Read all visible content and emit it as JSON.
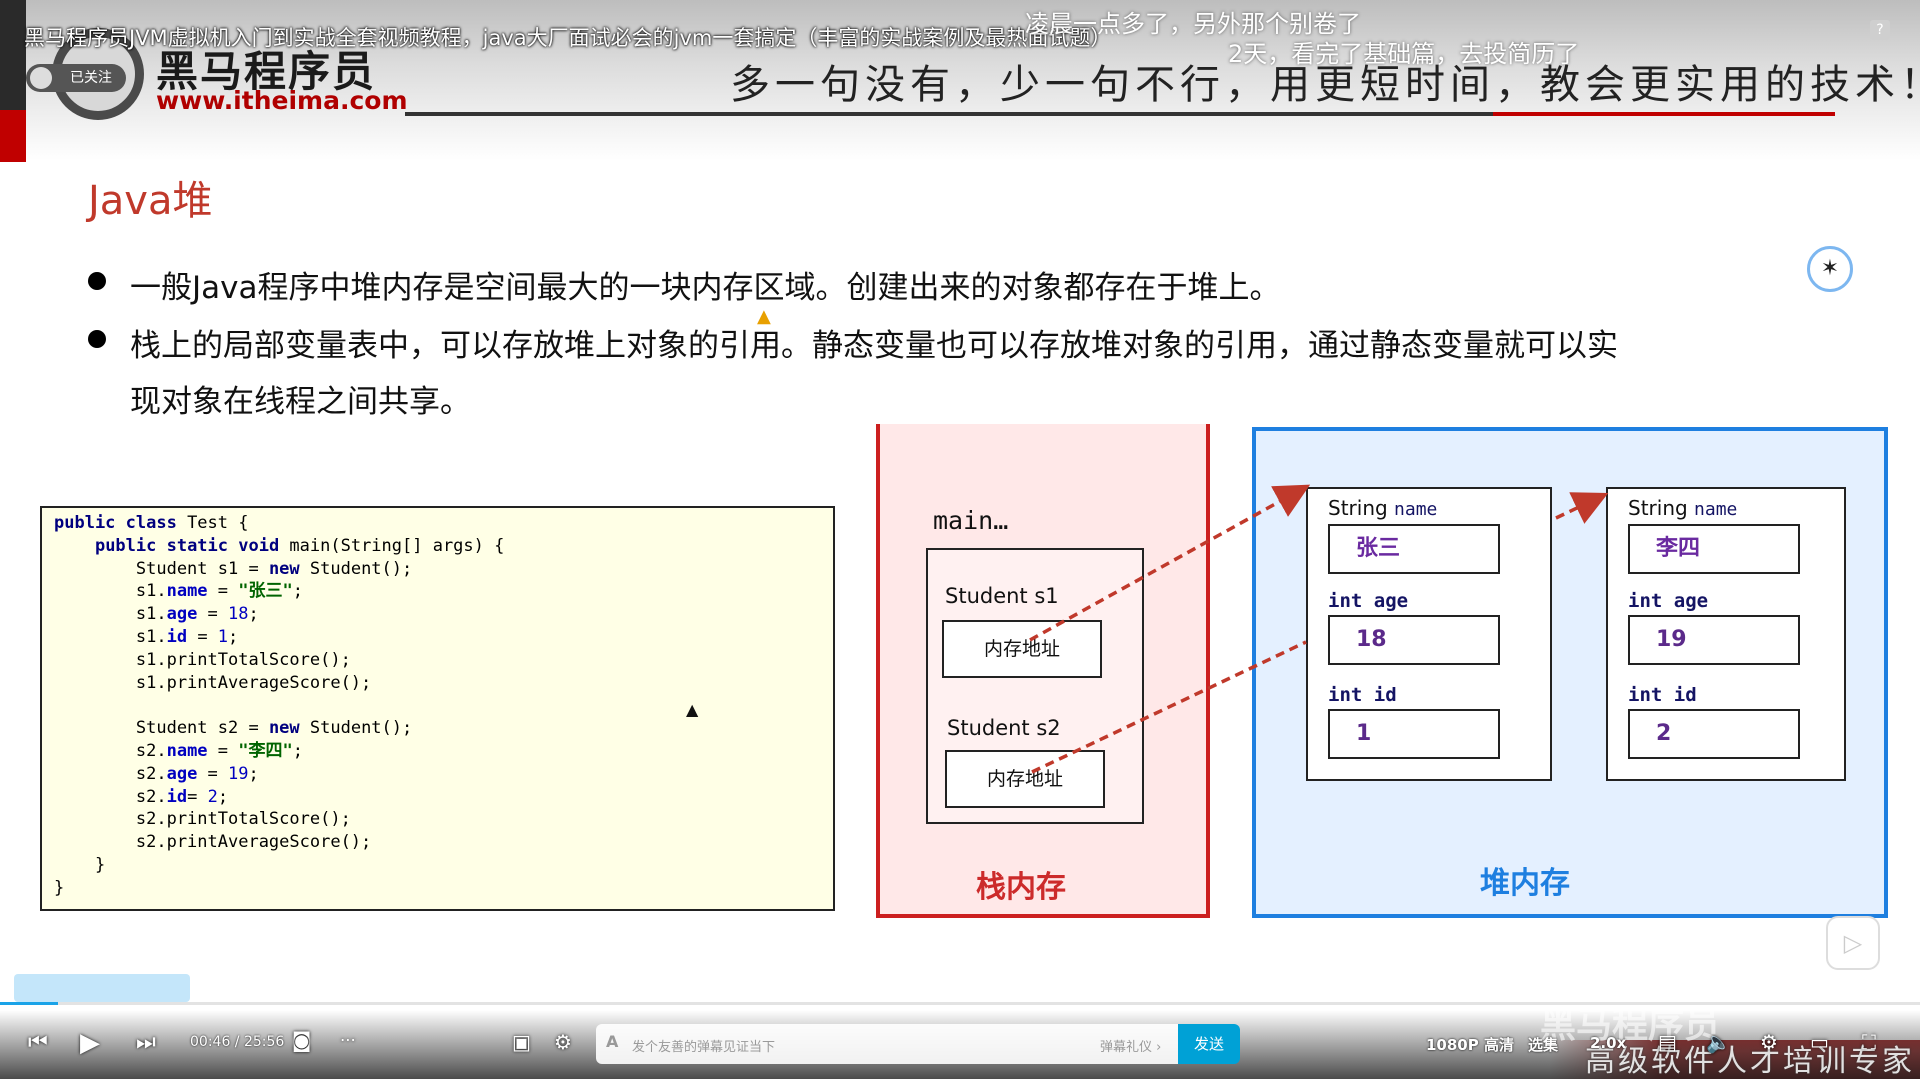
{
  "video": {
    "title": "黑马程序员JVM虚拟机入门到实战全套视频教程，java大厂面试必会的jvm一套搞定（丰富的实战案例及最热面试题）",
    "danmaku": [
      "凌晨一点多了，另外那个别卷了",
      "2天，看完了基础篇，去投简历了"
    ],
    "follow_label": "已关注",
    "help_label": "?"
  },
  "slide": {
    "brand_cn": "黑马程序员",
    "brand_url": "www.itheima.com",
    "slogan": "多一句没有，少一句不行，用更短时间，教会更实用的技术！",
    "section_title": "Java堆",
    "bullets": [
      "一般Java程序中堆内存是空间最大的一块内存区域。创建出来的对象都存在于堆上。",
      "栈上的局部变量表中，可以存放堆上对象的引用。静态变量也可以存放堆对象的引用，通过静态变量就可以实",
      "现对象在线程之间共享。"
    ],
    "code_lines": [
      [
        {
          "t": "public class",
          "c": "kw"
        },
        {
          "t": " Test {",
          "c": ""
        }
      ],
      [
        {
          "t": "    ",
          "c": ""
        },
        {
          "t": "public static void",
          "c": "kw"
        },
        {
          "t": " main(String[] args) {",
          "c": ""
        }
      ],
      [
        {
          "t": "        Student s1 = ",
          "c": ""
        },
        {
          "t": "new",
          "c": "kw"
        },
        {
          "t": " Student();",
          "c": ""
        }
      ],
      [
        {
          "t": "        s1.",
          "c": ""
        },
        {
          "t": "name",
          "c": "fld"
        },
        {
          "t": " = ",
          "c": ""
        },
        {
          "t": "\"张三\"",
          "c": "str"
        },
        {
          "t": ";",
          "c": ""
        }
      ],
      [
        {
          "t": "        s1.",
          "c": ""
        },
        {
          "t": "age",
          "c": "fld"
        },
        {
          "t": " = ",
          "c": ""
        },
        {
          "t": "18",
          "c": "num"
        },
        {
          "t": ";",
          "c": ""
        }
      ],
      [
        {
          "t": "        s1.",
          "c": ""
        },
        {
          "t": "id",
          "c": "fld"
        },
        {
          "t": " = ",
          "c": ""
        },
        {
          "t": "1",
          "c": "num"
        },
        {
          "t": ";",
          "c": ""
        }
      ],
      [
        {
          "t": "        s1.printTotalScore();",
          "c": ""
        }
      ],
      [
        {
          "t": "        s1.printAverageScore();",
          "c": ""
        }
      ],
      [
        {
          "t": "",
          "c": ""
        }
      ],
      [
        {
          "t": "        Student s2 = ",
          "c": ""
        },
        {
          "t": "new",
          "c": "kw"
        },
        {
          "t": " Student();",
          "c": ""
        }
      ],
      [
        {
          "t": "        s2.",
          "c": ""
        },
        {
          "t": "name",
          "c": "fld"
        },
        {
          "t": " = ",
          "c": ""
        },
        {
          "t": "\"李四\"",
          "c": "str"
        },
        {
          "t": ";",
          "c": ""
        }
      ],
      [
        {
          "t": "        s2.",
          "c": ""
        },
        {
          "t": "age",
          "c": "fld"
        },
        {
          "t": " = ",
          "c": ""
        },
        {
          "t": "19",
          "c": "num"
        },
        {
          "t": ";",
          "c": ""
        }
      ],
      [
        {
          "t": "        s2.",
          "c": ""
        },
        {
          "t": "id",
          "c": "fld"
        },
        {
          "t": "= ",
          "c": ""
        },
        {
          "t": "2",
          "c": "num"
        },
        {
          "t": ";",
          "c": ""
        }
      ],
      [
        {
          "t": "        s2.printTotalScore();",
          "c": ""
        }
      ],
      [
        {
          "t": "        s2.printAverageScore();",
          "c": ""
        }
      ],
      [
        {
          "t": "    }",
          "c": ""
        }
      ],
      [
        {
          "t": "}",
          "c": ""
        }
      ]
    ],
    "stack": {
      "frame_label": "main…",
      "vars": [
        {
          "label": "Student   s1",
          "addr": "内存地址"
        },
        {
          "label": "Student   s2",
          "addr": "内存地址"
        }
      ],
      "title": "栈内存"
    },
    "heap": {
      "title": "堆内存",
      "objects": [
        {
          "name_label_type": "String",
          "name_label_field": "name",
          "name_value": "张三",
          "age_label": "int age",
          "age_value": "18",
          "id_label": "int id",
          "id_value": "1"
        },
        {
          "name_label_type": "String",
          "name_label_field": "name",
          "name_value": "李四",
          "age_label": "int age",
          "age_value": "19",
          "id_label": "int id",
          "id_value": "2"
        }
      ]
    }
  },
  "player": {
    "time": "00:46 / 25:56",
    "progress_fraction": 0.03,
    "danmu_placeholder": "发个友善的弹幕见证当下",
    "danmu_etiquette": "弹幕礼仪 ›",
    "send_label": "发送",
    "quality": "1080P 高清",
    "episodes": "选集",
    "speed": "2.0x",
    "watermark": "高级软件人才培训专家",
    "watermark_brand": "黑马程序员"
  },
  "colors": {
    "accent_red": "#c00000",
    "stack_border": "#cc1f1f",
    "heap_border": "#1e7fe0",
    "send_button": "#00a1d6",
    "progress": "#1aa3e8"
  }
}
